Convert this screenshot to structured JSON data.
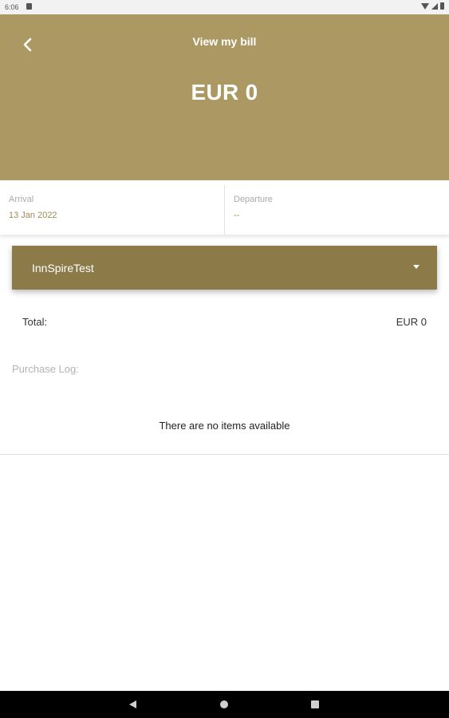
{
  "status_bar": {
    "time": "6:06"
  },
  "header": {
    "title": "View my bill",
    "amount": "EUR 0"
  },
  "stay": {
    "arrival_label": "Arrival",
    "arrival_value": "13 Jan 2022",
    "departure_label": "Departure",
    "departure_value": "--"
  },
  "property": {
    "selected": "InnSpireTest"
  },
  "totals": {
    "label": "Total:",
    "value": "EUR 0"
  },
  "purchase_log": {
    "label": "Purchase Log:",
    "empty_message": "There are no items available"
  },
  "colors": {
    "header_bg": "#ab9862",
    "dropdown_bg": "#8c7b49",
    "date_accent": "#a08b52"
  },
  "icons": {
    "back": "chevron-left-icon",
    "dropdown": "caret-down-icon"
  }
}
